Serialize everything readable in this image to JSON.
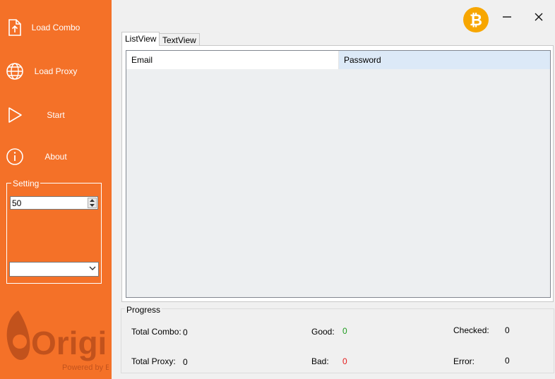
{
  "sidebar": {
    "items": [
      {
        "label": "Load Combo",
        "icon": "file-upload-icon"
      },
      {
        "label": "Load Proxy",
        "icon": "globe-icon"
      },
      {
        "label": "Start",
        "icon": "play-icon"
      },
      {
        "label": "About",
        "icon": "info-icon"
      }
    ],
    "setting": {
      "legend": "Setting",
      "threads_value": "50",
      "proxy_type_value": ""
    },
    "logo": {
      "brand": "Origin",
      "tagline": "Powered by EA"
    }
  },
  "titlebar": {
    "icons": [
      "bitcoin-icon",
      "minimize-icon",
      "close-icon"
    ],
    "accent": "#f7a600"
  },
  "tabs": [
    {
      "label": "ListView",
      "active": true
    },
    {
      "label": "TextView",
      "active": false
    }
  ],
  "list": {
    "columns": [
      "Email",
      "Password"
    ],
    "rows": []
  },
  "progress": {
    "legend": "Progress",
    "total_combo_label": "Total Combo:",
    "total_combo": "0",
    "total_proxy_label": "Total Proxy:",
    "total_proxy": "0",
    "good_label": "Good:",
    "good": "0",
    "bad_label": "Bad:",
    "bad": "0",
    "checked_label": "Checked:",
    "checked": "0",
    "error_label": "Error:",
    "error": "0"
  },
  "colors": {
    "sidebar": "#f47128",
    "good": "#1e9b1e",
    "bad": "#e51c1c",
    "selected_header": "#dce9f7"
  }
}
